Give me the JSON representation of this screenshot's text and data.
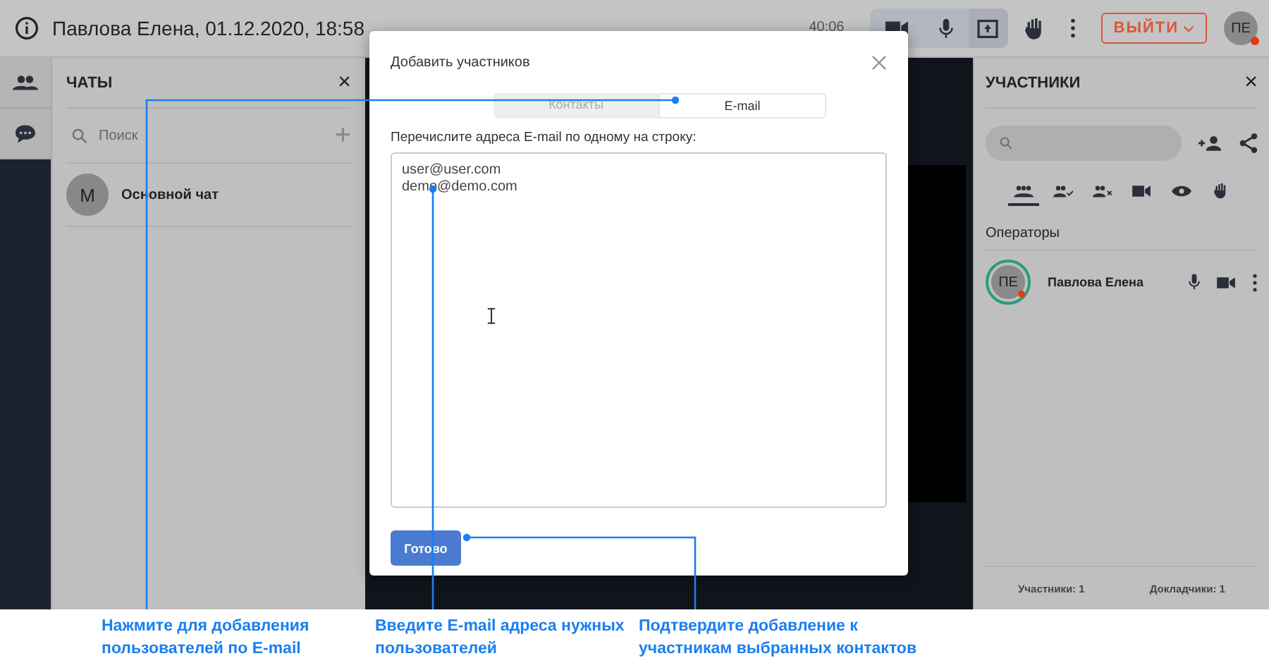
{
  "header": {
    "title": "Павлова Елена, 01.12.2020, 18:58",
    "timer": "40:06",
    "exit_button": "ВЫЙТИ",
    "avatar": "ПЕ"
  },
  "chats_panel": {
    "title": "ЧАТЫ",
    "close": "×",
    "search": {
      "placeholder": "Поиск"
    },
    "add": "+",
    "chats": [
      {
        "initial": "M",
        "name": "Основной чат"
      }
    ]
  },
  "modal": {
    "title": "Добавить участников",
    "tabs": [
      {
        "label": "Контакты",
        "selected": false
      },
      {
        "label": "E-mail",
        "selected": true
      }
    ],
    "prompt": "Перечислите адреса E-mail по одному на строку:",
    "emails": "user@user.com\ndemo@demo.com",
    "button": "Готово"
  },
  "participants_panel": {
    "title": "УЧАСТНИКИ",
    "close": "×",
    "filters": [
      {
        "kind": "all",
        "selected": true
      },
      {
        "kind": "confirmed",
        "selected": false
      },
      {
        "kind": "declined",
        "selected": false
      },
      {
        "kind": "video",
        "selected": false
      },
      {
        "kind": "viewers",
        "selected": false
      },
      {
        "kind": "hand",
        "selected": false
      }
    ],
    "section": "Операторы",
    "participants": [
      {
        "initials": "ПЕ",
        "name": "Павлова Елена"
      }
    ],
    "footer": [
      "Участники: 1",
      "Докладчики: 1"
    ]
  },
  "callouts": [
    "Нажмите для добавления пользователей по E-mail",
    "Введите E-mail адреса нужных пользователей",
    "Подтвердите добавление к участникам выбранных контактов"
  ]
}
